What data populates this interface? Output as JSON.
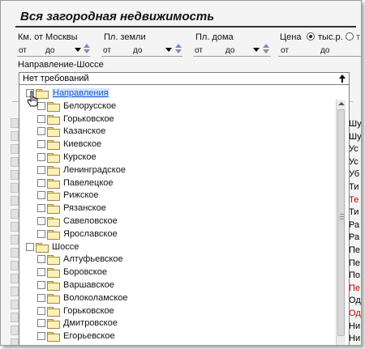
{
  "title": "Вся загородная недвижимость",
  "filters": {
    "km_label": "Км. от Москвы",
    "land_label": "Пл. земли",
    "house_label": "Пл. дома",
    "price_label": "Цена",
    "price_unit_selected": "тыс.р.",
    "from_text": "от",
    "to_text": "до",
    "direction_label": "Направление-Шоссе"
  },
  "dropdown": {
    "value": "Нет требований"
  },
  "tree": {
    "root1": "Направления",
    "directions": [
      "Белорусское",
      "Горьковское",
      "Казанское",
      "Киевское",
      "Курское",
      "Ленинградское",
      "Павелецкое",
      "Рижское",
      "Рязанское",
      "Савеловское",
      "Ярославское"
    ],
    "root2": "Шоссе",
    "highways": [
      "Алтуфьевское",
      "Боровское",
      "Варшавское",
      "Волоколамское",
      "Горьковское",
      "Дмитровское",
      "Егорьевское"
    ]
  },
  "right_fragments": [
    {
      "t": "Шу",
      "c": "#000000"
    },
    {
      "t": "Шу",
      "c": "#000000"
    },
    {
      "t": "Ус",
      "c": "#000000"
    },
    {
      "t": "Ус",
      "c": "#000000"
    },
    {
      "t": "Уб",
      "c": "#000000"
    },
    {
      "t": "Ти",
      "c": "#000000"
    },
    {
      "t": "Те",
      "c": "#cc0000"
    },
    {
      "t": "Ти",
      "c": "#000000"
    },
    {
      "t": "Ра",
      "c": "#000000"
    },
    {
      "t": "Ра",
      "c": "#000000"
    },
    {
      "t": "Пе",
      "c": "#000000"
    },
    {
      "t": "Пе",
      "c": "#000000"
    },
    {
      "t": "По",
      "c": "#000000"
    },
    {
      "t": "Пе",
      "c": "#cc0000"
    },
    {
      "t": "Од",
      "c": "#000000"
    },
    {
      "t": "Од",
      "c": "#cc0000"
    },
    {
      "t": "Ни",
      "c": "#000000"
    },
    {
      "t": "Ни",
      "c": "#000000"
    },
    {
      "t": "Ни",
      "c": "#000000"
    }
  ]
}
